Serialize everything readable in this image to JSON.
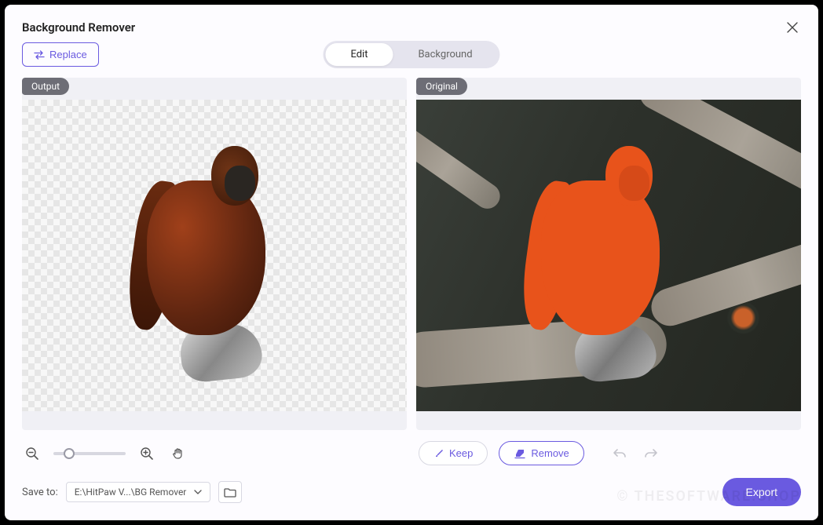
{
  "window": {
    "title": "Background Remover"
  },
  "toolbar": {
    "replace_label": "Replace"
  },
  "tabs": {
    "edit": "Edit",
    "background": "Background",
    "active": "edit"
  },
  "panels": {
    "output_badge": "Output",
    "original_badge": "Original"
  },
  "actions": {
    "keep_label": "Keep",
    "remove_label": "Remove"
  },
  "save": {
    "label": "Save to:",
    "path": "E:\\HitPaw V...\\BG Remover"
  },
  "export": {
    "label": "Export"
  },
  "zoom": {
    "value_percent": 22
  },
  "colors": {
    "accent": "#6a5ae0",
    "mask": "#e8531b"
  },
  "watermark": "© THESOFTWARE.SHOP"
}
